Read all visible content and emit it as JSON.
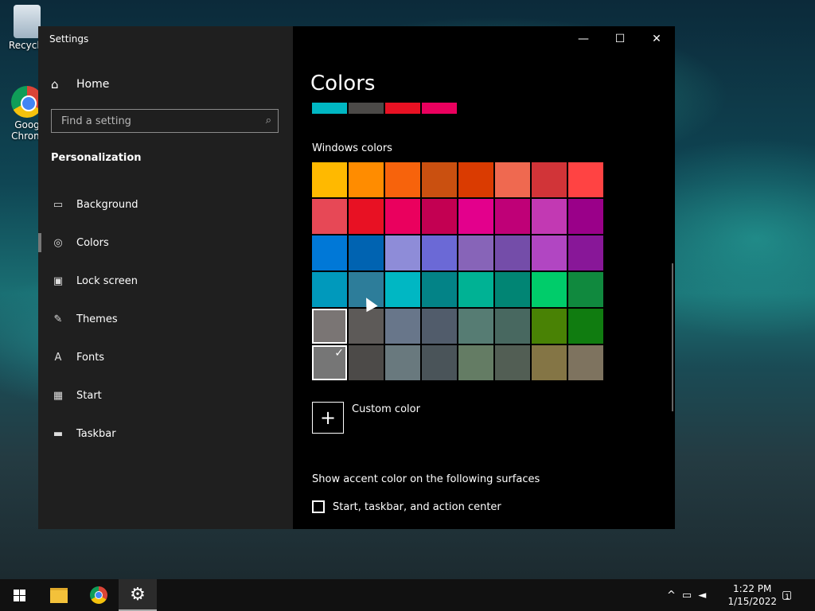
{
  "desktop": {
    "icons": [
      {
        "label": "Recycle"
      },
      {
        "label": "Goog\nChrom"
      }
    ]
  },
  "window": {
    "title": "Settings",
    "minimize": "—",
    "maximize": "☐",
    "close": "✕"
  },
  "sidebar": {
    "home_label": "Home",
    "search_placeholder": "Find a setting",
    "section": "Personalization",
    "items": [
      {
        "label": "Background",
        "icon": "image-icon"
      },
      {
        "label": "Colors",
        "icon": "palette-icon"
      },
      {
        "label": "Lock screen",
        "icon": "lock-screen-icon"
      },
      {
        "label": "Themes",
        "icon": "themes-icon"
      },
      {
        "label": "Fonts",
        "icon": "fonts-icon"
      },
      {
        "label": "Start",
        "icon": "start-icon"
      },
      {
        "label": "Taskbar",
        "icon": "taskbar-icon"
      }
    ],
    "active_item": "Colors"
  },
  "main": {
    "title": "Colors",
    "recent_colors": [
      "#00b7c3",
      "#4c4a48",
      "#e81123",
      "#ea005e"
    ],
    "windows_colors_label": "Windows colors",
    "swatches": [
      [
        "#ffb900",
        "#ff8c00",
        "#f7630c",
        "#ca5010",
        "#da3b01",
        "#ef6950",
        "#d13438",
        "#ff4343"
      ],
      [
        "#e74856",
        "#e81123",
        "#ea005e",
        "#c30052",
        "#e3008c",
        "#bf0077",
        "#c239b3",
        "#9a0089"
      ],
      [
        "#0078d7",
        "#0063b1",
        "#8e8cd8",
        "#6b69d6",
        "#8764b8",
        "#744da9",
        "#b146c2",
        "#881798"
      ],
      [
        "#0099bc",
        "#2d7d9a",
        "#00b7c3",
        "#038387",
        "#00b294",
        "#018574",
        "#00cc6a",
        "#10893e"
      ],
      [
        "#7a7574",
        "#5d5a58",
        "#68768a",
        "#515c6b",
        "#567c73",
        "#486860",
        "#498205",
        "#107c10"
      ],
      [
        "#767676",
        "#4c4a48",
        "#69797e",
        "#4a5459",
        "#647c64",
        "#525e54",
        "#847545",
        "#7e735f"
      ]
    ],
    "selected_swatch": "row6-col1",
    "custom_color_label": "Custom color",
    "accent_heading": "Show accent color on the following surfaces",
    "checkbox_label": "Start, taskbar, and action center",
    "checkbox_checked": false
  },
  "taskbar": {
    "time": "1:22 PM",
    "date": "1/15/2022",
    "notification_count": "1"
  }
}
